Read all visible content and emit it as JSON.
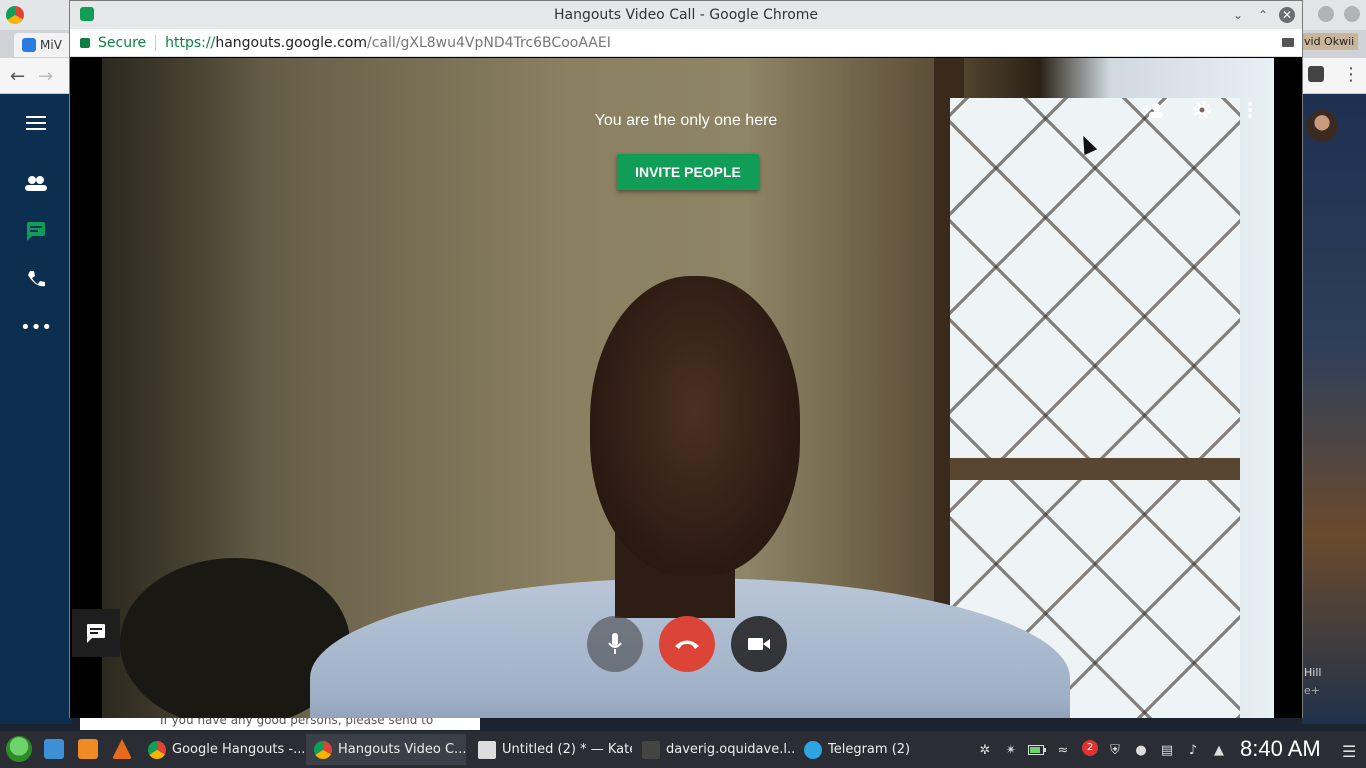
{
  "background_window": {
    "tab_label": "MiV",
    "profile_name": "vid Okwii",
    "side_text": "Hill",
    "side_text_2": "e+",
    "message_preview": "If you have any good persons, please send to"
  },
  "popup": {
    "title": "Hangouts Video Call - Google Chrome",
    "secure_label": "Secure",
    "url_scheme": "https://",
    "url_host": "hangouts.google.com",
    "url_path": "/call/gXL8wu4VpND4Trc6BCooAAEI"
  },
  "call": {
    "status_text": "You are the only one here",
    "invite_button": "INVITE PEOPLE"
  },
  "taskbar": {
    "tasks": [
      {
        "label": "Google Hangouts -..."
      },
      {
        "label": "Hangouts Video C..."
      },
      {
        "label": "Untitled (2) * — Kate"
      },
      {
        "label": "daverig.oquidave.l..."
      },
      {
        "label": "Telegram (2)"
      }
    ],
    "notification_count": "2",
    "clock": "8:40 AM"
  },
  "colors": {
    "invite_green": "#0f9d58",
    "end_call_red": "#db4437",
    "secure_green": "#0b8043"
  }
}
